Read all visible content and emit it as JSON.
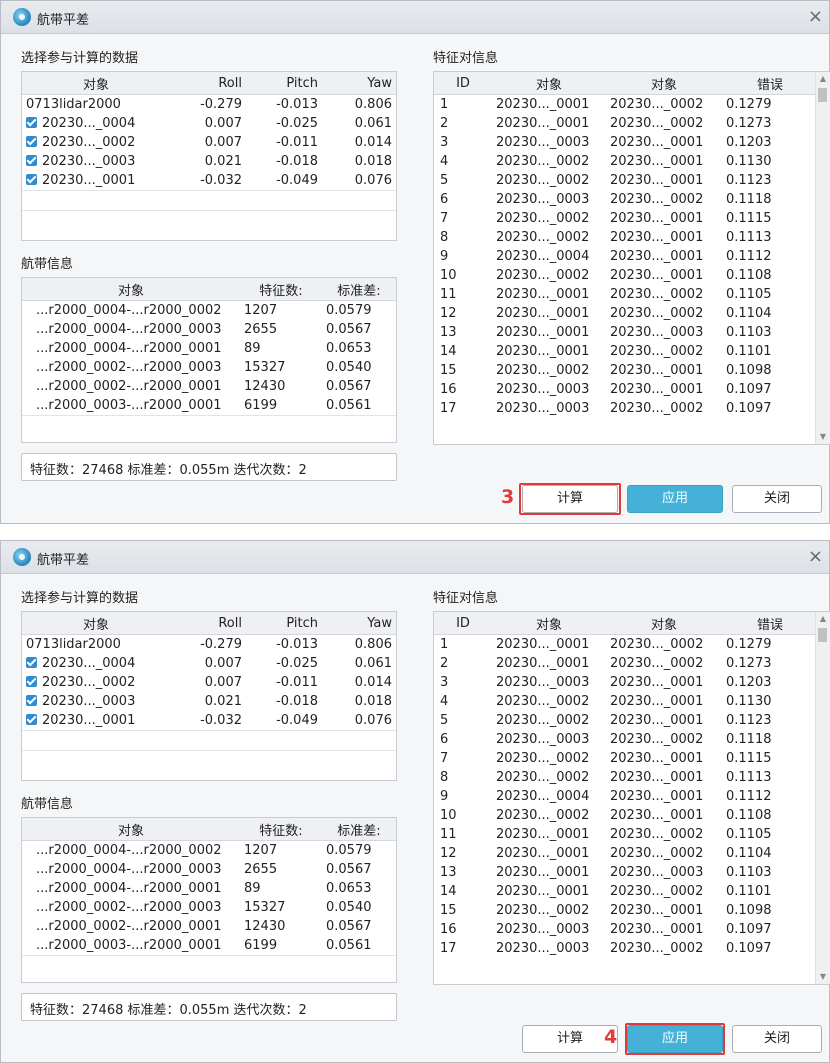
{
  "dialog": {
    "title": "航带平差",
    "close_icon": "×",
    "app_icon": "flight-strip-icon"
  },
  "sections": {
    "select_data": "选择参与计算的数据",
    "strip_info": "航带信息",
    "feature_pairs": "特征对信息"
  },
  "data_table": {
    "headers": [
      "对象",
      "Roll",
      "Pitch",
      "Yaw"
    ],
    "rows": [
      {
        "object": "0713lidar2000",
        "checked": false,
        "roll": "-0.279",
        "pitch": "-0.013",
        "yaw": "0.806"
      },
      {
        "object": "20230..._0004",
        "checked": true,
        "roll": "0.007",
        "pitch": "-0.025",
        "yaw": "0.061"
      },
      {
        "object": "20230..._0002",
        "checked": true,
        "roll": "0.007",
        "pitch": "-0.011",
        "yaw": "0.014"
      },
      {
        "object": "20230..._0003",
        "checked": true,
        "roll": "0.021",
        "pitch": "-0.018",
        "yaw": "0.018"
      },
      {
        "object": "20230..._0001",
        "checked": true,
        "roll": "-0.032",
        "pitch": "-0.049",
        "yaw": "0.076"
      }
    ]
  },
  "strip_table": {
    "headers": [
      "对象",
      "特征数:",
      "标准差:"
    ],
    "rows": [
      {
        "object": "...r2000_0004-...r2000_0002",
        "count": "1207",
        "std": "0.0579"
      },
      {
        "object": "...r2000_0004-...r2000_0003",
        "count": "2655",
        "std": "0.0567"
      },
      {
        "object": "...r2000_0004-...r2000_0001",
        "count": "89",
        "std": "0.0653"
      },
      {
        "object": "...r2000_0002-...r2000_0003",
        "count": "15327",
        "std": "0.0540"
      },
      {
        "object": "...r2000_0002-...r2000_0001",
        "count": "12430",
        "std": "0.0567"
      },
      {
        "object": "...r2000_0003-...r2000_0001",
        "count": "6199",
        "std": "0.0561"
      }
    ]
  },
  "status": "特征数：27468 标准差：0.055m 迭代次数：2",
  "feature_table": {
    "headers": [
      "ID",
      "对象",
      "对象",
      "错误"
    ],
    "rows": [
      {
        "id": "1",
        "a": "20230..._0001",
        "b": "20230..._0002",
        "err": "0.1279"
      },
      {
        "id": "2",
        "a": "20230..._0001",
        "b": "20230..._0002",
        "err": "0.1273"
      },
      {
        "id": "3",
        "a": "20230..._0003",
        "b": "20230..._0001",
        "err": "0.1203"
      },
      {
        "id": "4",
        "a": "20230..._0002",
        "b": "20230..._0001",
        "err": "0.1130"
      },
      {
        "id": "5",
        "a": "20230..._0002",
        "b": "20230..._0001",
        "err": "0.1123"
      },
      {
        "id": "6",
        "a": "20230..._0003",
        "b": "20230..._0002",
        "err": "0.1118"
      },
      {
        "id": "7",
        "a": "20230..._0002",
        "b": "20230..._0001",
        "err": "0.1115"
      },
      {
        "id": "8",
        "a": "20230..._0002",
        "b": "20230..._0001",
        "err": "0.1113"
      },
      {
        "id": "9",
        "a": "20230..._0004",
        "b": "20230..._0001",
        "err": "0.1112"
      },
      {
        "id": "10",
        "a": "20230..._0002",
        "b": "20230..._0001",
        "err": "0.1108"
      },
      {
        "id": "11",
        "a": "20230..._0001",
        "b": "20230..._0002",
        "err": "0.1105"
      },
      {
        "id": "12",
        "a": "20230..._0001",
        "b": "20230..._0002",
        "err": "0.1104"
      },
      {
        "id": "13",
        "a": "20230..._0001",
        "b": "20230..._0003",
        "err": "0.1103"
      },
      {
        "id": "14",
        "a": "20230..._0001",
        "b": "20230..._0002",
        "err": "0.1101"
      },
      {
        "id": "15",
        "a": "20230..._0002",
        "b": "20230..._0001",
        "err": "0.1098"
      },
      {
        "id": "16",
        "a": "20230..._0003",
        "b": "20230..._0001",
        "err": "0.1097"
      },
      {
        "id": "17",
        "a": "20230..._0003",
        "b": "20230..._0002",
        "err": "0.1097"
      }
    ]
  },
  "buttons": {
    "compute": "计算",
    "apply": "应用",
    "close": "关闭"
  },
  "steps": {
    "first": "3",
    "second": "4"
  },
  "colors": {
    "apply_button": "#45b1d6",
    "highlight_box": "#e03a3a",
    "checkbox": "#2f8ccf"
  }
}
